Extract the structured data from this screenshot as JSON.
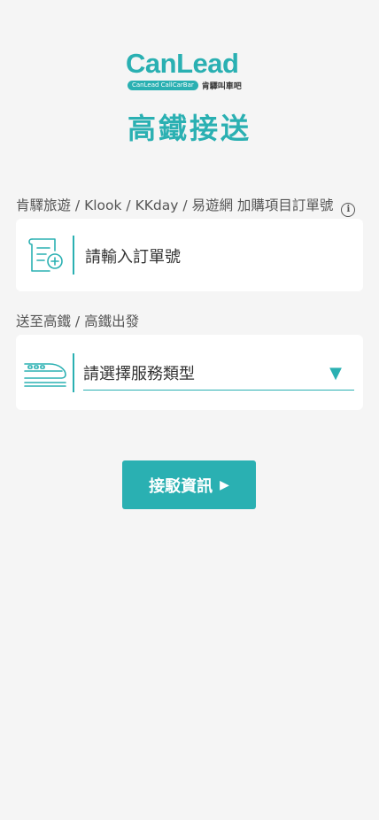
{
  "brand": {
    "wordmark": "CanLead",
    "pill_text": "CanLead CallCarBar",
    "subtitle_zh": "肯驛叫車吧",
    "accent_color": "#2ab0b2"
  },
  "page_title": "高鐵接送",
  "order_section": {
    "label": "肯驛旅遊 / Klook / KKday / 易遊網 加購項目訂單號",
    "info_icon": "ⓘ",
    "placeholder": "請輸入訂單號",
    "value": ""
  },
  "service_section": {
    "label": "送至高鐵 / 高鐵出發",
    "select_value": "請選擇服務類型",
    "caret": "▼"
  },
  "next_button": {
    "label": "接駁資訊",
    "arrow": "▶"
  }
}
